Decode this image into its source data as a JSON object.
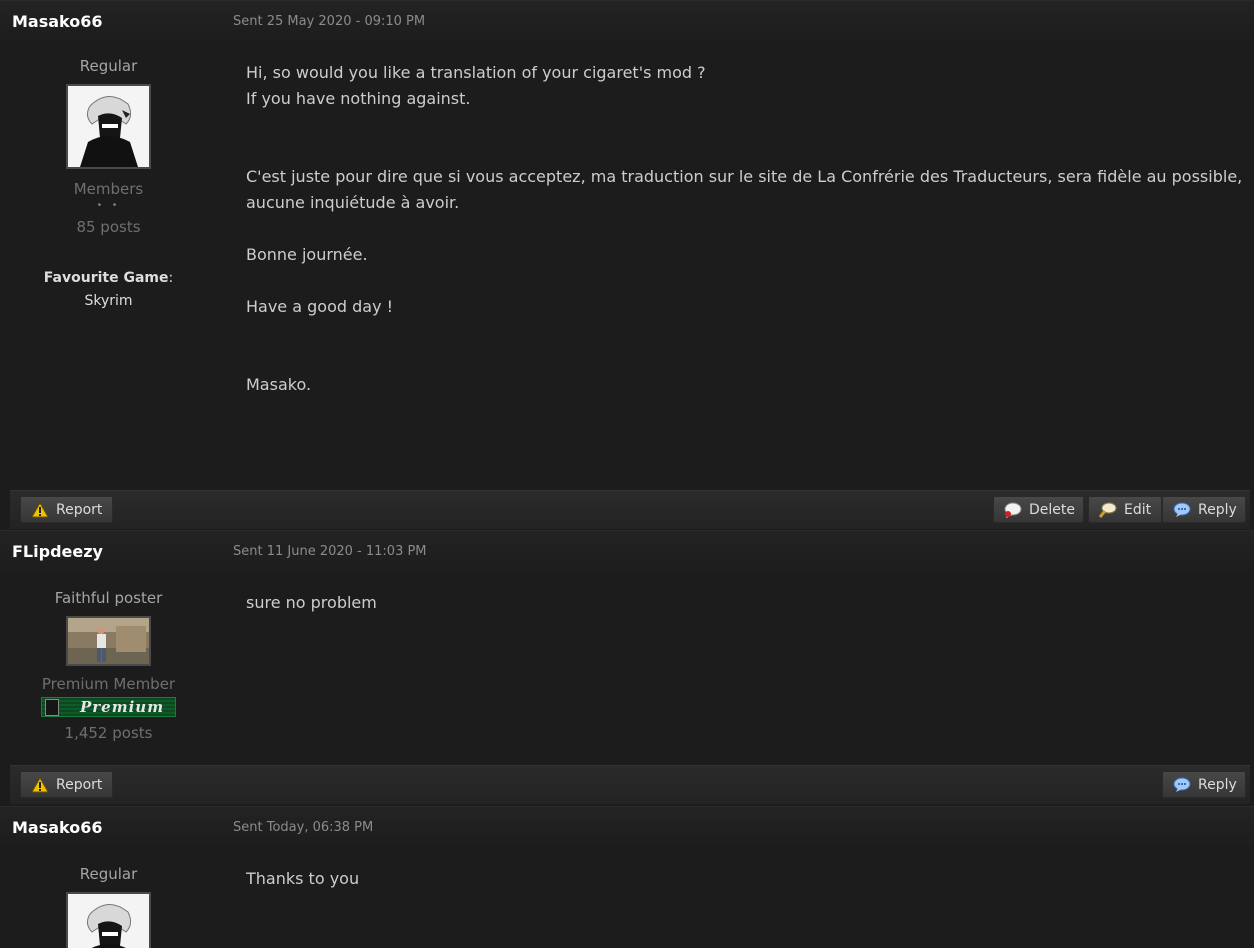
{
  "posts": [
    {
      "author": "Masako66",
      "date": "Sent 25 May 2020 - 09:10 PM",
      "rank": "Regular",
      "group": "Members",
      "pips": "• •",
      "post_count": "85 posts",
      "favourite_game_label": "Favourite Game",
      "favourite_game_sep": ":",
      "favourite_game": "Skyrim",
      "body": [
        "Hi, so would you like a translation of your cigaret's mod ?",
        "If you have nothing against.",
        "C'est juste pour dire que si vous acceptez, ma traduction sur le site de La Confrérie des Traducteurs, sera fidèle au possible,",
        "aucune inquiétude à avoir.",
        "Bonne journée.",
        "Have a good day !",
        "Masako."
      ],
      "buttons": {
        "report": "Report",
        "delete": "Delete",
        "edit": "Edit",
        "reply": "Reply"
      }
    },
    {
      "author": "FLipdeezy",
      "date": "Sent 11 June 2020 - 11:03 PM",
      "rank": "Faithful poster",
      "group": "Premium Member",
      "badge_text": "Premium",
      "post_count": "1,452 posts",
      "body": [
        "sure no problem"
      ],
      "buttons": {
        "report": "Report",
        "reply": "Reply"
      }
    },
    {
      "author": "Masako66",
      "date": "Sent Today, 06:38 PM",
      "rank": "Regular",
      "body": [
        "Thanks to you"
      ]
    }
  ],
  "colors": {
    "background": "#1c1c1c",
    "author_name": "#ffffff",
    "date": "#8b8b8b",
    "premium_badge": "#0e5a28",
    "report_icon": "#f2c200",
    "reply_icon": "#9fc8ff"
  },
  "icons": {
    "report": "warning-icon",
    "delete": "speech-bubble-delete-icon",
    "edit": "magnifier-edit-icon",
    "reply": "speech-bubble-reply-icon"
  }
}
